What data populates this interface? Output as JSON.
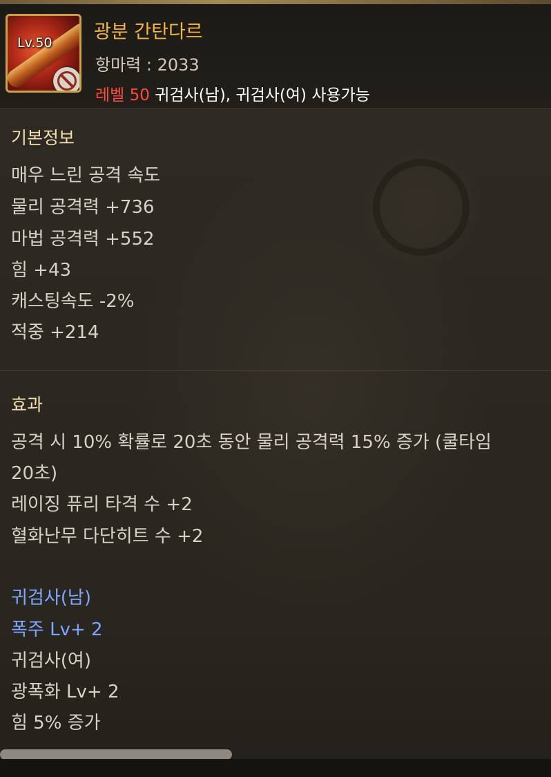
{
  "header": {
    "level_badge": "Lv.50",
    "item_name": "광분 간탄다르",
    "stat_line": "항마력 : 2033",
    "req_level": "레벨 50",
    "req_classes": " 귀검사(남), 귀검사(여) 사용가능"
  },
  "basic": {
    "title": "기본정보",
    "lines": [
      "매우 느린 공격 속도",
      "물리 공격력 +736",
      "마법 공격력 +552",
      "힘 +43",
      "캐스팅속도 -2%",
      "적중 +214"
    ]
  },
  "effect": {
    "title": "효과",
    "lines": [
      "공격 시 10% 확률로 20초 동안 물리 공격력 15% 증가 (쿨타임",
      "20초)",
      "레이징 퓨리 타격 수 +2",
      "혈화난무 다단히트 수 +2"
    ]
  },
  "class_bonus": {
    "male_class": "귀검사(남)",
    "male_skill": "폭주 Lv+ 2",
    "female_class": "귀검사(여)",
    "female_skill": "광폭화 Lv+ 2",
    "female_extra": "힘 5% 증가"
  },
  "colors": {
    "item_name": "#f2b648",
    "section_title": "#f6dfae",
    "body_text": "#d8d1c6",
    "level_requirement": "#ff4a3c",
    "class_highlight": "#7fa6ff",
    "icon_border": "#c9a24c"
  },
  "icons": {
    "item_icon": "red-greatsword-icon",
    "restriction_icon": "prohibited-icon"
  },
  "scroll": {
    "horizontal_position_fraction": 0.42
  }
}
